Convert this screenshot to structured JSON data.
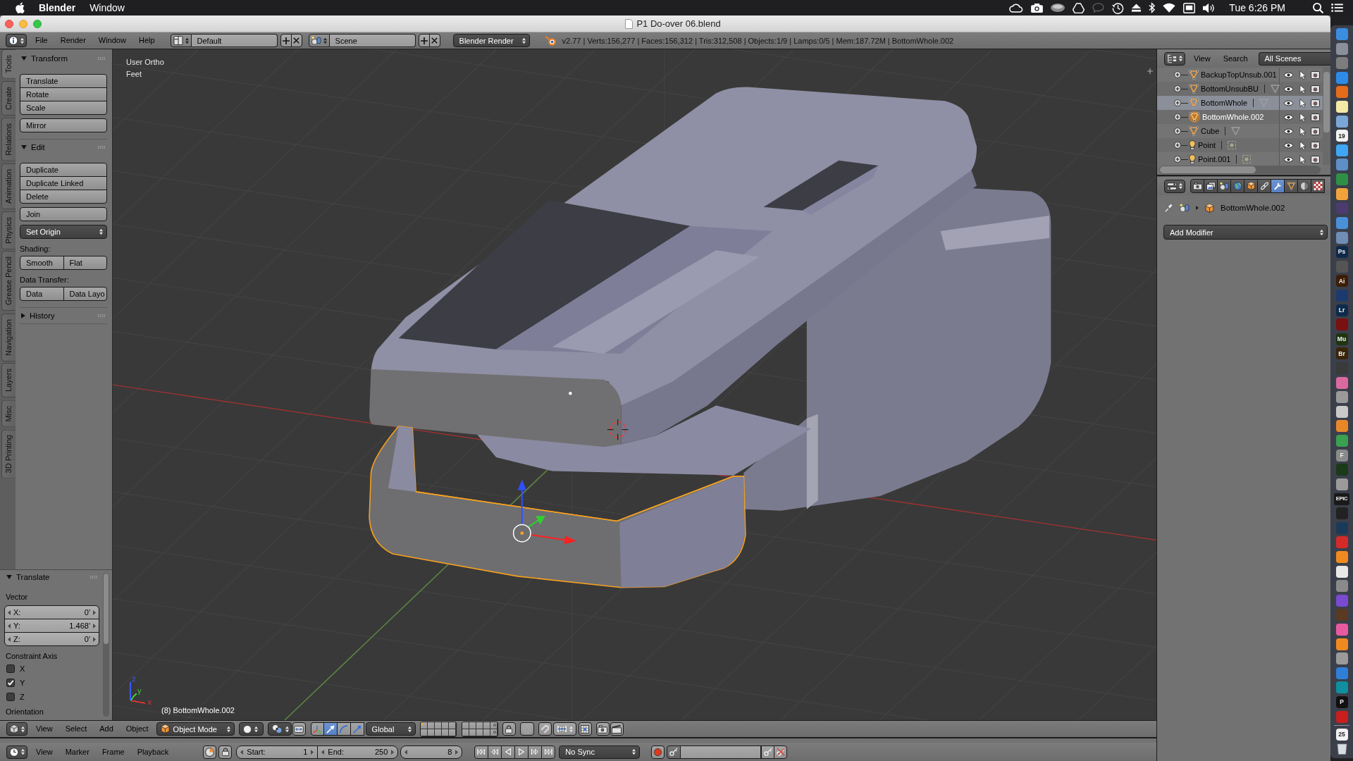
{
  "menu_bar": {
    "app_name": "Blender",
    "menus": [
      "Window"
    ],
    "clock": "Tue 6:26 PM"
  },
  "window": {
    "title": "P1 Do-over 06.blend"
  },
  "info_header": {
    "menus": [
      "File",
      "Render",
      "Window",
      "Help"
    ],
    "screen_layout": "Default",
    "scene": "Scene",
    "render_engine": "Blender Render",
    "stats": "v2.77 | Verts:156,277 | Faces:156,312 | Tris:312,508 | Objects:1/9 | Lamps:0/5 | Mem:187.72M | BottomWhole.002"
  },
  "tool_shelf": {
    "tabs": [
      {
        "label": "Tools",
        "selected": true
      },
      {
        "label": "Create",
        "selected": false
      },
      {
        "label": "Relations",
        "selected": false
      },
      {
        "label": "Animation",
        "selected": false
      },
      {
        "label": "Physics",
        "selected": false
      },
      {
        "label": "Grease Pencil",
        "selected": false
      },
      {
        "label": "Navigation",
        "selected": false
      },
      {
        "label": "Layers",
        "selected": false
      },
      {
        "label": "Misc",
        "selected": false
      },
      {
        "label": "3D Printing",
        "selected": false
      }
    ],
    "panels": [
      {
        "title": "Transform",
        "expanded": true,
        "items": [
          {
            "kind": "stack",
            "buttons": [
              "Translate",
              "Rotate",
              "Scale"
            ]
          },
          {
            "kind": "stack",
            "buttons": [
              "Mirror"
            ]
          }
        ]
      },
      {
        "title": "Edit",
        "expanded": true,
        "items": [
          {
            "kind": "stack",
            "buttons": [
              "Duplicate",
              "Duplicate Linked",
              "Delete"
            ]
          },
          {
            "kind": "stack",
            "buttons": [
              "Join"
            ]
          },
          {
            "kind": "dropdown",
            "label": "Set Origin"
          },
          {
            "kind": "label",
            "text": "Shading:"
          },
          {
            "kind": "row",
            "buttons": [
              "Smooth",
              "Flat"
            ]
          },
          {
            "kind": "label",
            "text": "Data Transfer:"
          },
          {
            "kind": "row",
            "buttons": [
              "Data",
              "Data Layo"
            ]
          }
        ]
      },
      {
        "title": "History",
        "expanded": false
      }
    ]
  },
  "operator_panel": {
    "title": "Translate",
    "expanded": true,
    "vector_label": "Vector",
    "vector": [
      {
        "axis": "X:",
        "value": "0'"
      },
      {
        "axis": "Y:",
        "value": "1.468'"
      },
      {
        "axis": "Z:",
        "value": "0'"
      }
    ],
    "constraint_label": "Constraint Axis",
    "constraint_axes": [
      {
        "label": "X",
        "checked": false
      },
      {
        "label": "Y",
        "checked": true
      },
      {
        "label": "Z",
        "checked": false
      }
    ],
    "orientation_label": "Orientation"
  },
  "viewport": {
    "view_name": "User Ortho",
    "units": "Feet",
    "gizmo_axes": [
      {
        "label": "x",
        "color": "#d23232"
      },
      {
        "label": "y",
        "color": "#3cc83c"
      },
      {
        "label": "z",
        "color": "#3c5aff"
      }
    ],
    "active_object": "(8) BottomWhole.002"
  },
  "view_header": {
    "menus": [
      "View",
      "Select",
      "Add",
      "Object"
    ],
    "mode": "Object Mode",
    "manipulators": [
      {
        "selected": true
      },
      {
        "selected": false
      },
      {
        "selected": false
      }
    ],
    "orientation": "Global",
    "layers": [
      {
        "kind": "active_object"
      },
      {
        "kind": "empty"
      },
      {
        "kind": "empty"
      },
      {
        "kind": "empty"
      },
      {
        "kind": "empty"
      },
      {
        "kind": "empty"
      },
      {
        "kind": "empty"
      },
      {
        "kind": "empty"
      },
      {
        "kind": "empty"
      },
      {
        "kind": "has_objects"
      },
      {
        "kind": "empty"
      },
      {
        "kind": "empty"
      },
      {
        "kind": "empty"
      },
      {
        "kind": "empty"
      },
      {
        "kind": "empty"
      },
      {
        "kind": "empty"
      },
      {
        "kind": "empty"
      },
      {
        "kind": "empty"
      },
      {
        "kind": "empty"
      },
      {
        "kind": "has_objects"
      }
    ]
  },
  "timeline_header": {
    "menus": [
      "View",
      "Marker",
      "Frame",
      "Playback"
    ],
    "start_label": "Start:",
    "start": "1",
    "end_label": "End:",
    "end": "250",
    "current_frame": "8",
    "sync": "No Sync"
  },
  "outliner": {
    "menus": [
      "View",
      "Search"
    ],
    "display_mode": "All Scenes",
    "items": [
      {
        "name": "BackupTopUnsub.001",
        "kind": "mesh",
        "selected": false,
        "active": false,
        "data_icon": false
      },
      {
        "name": "BottomUnsubBU",
        "kind": "mesh",
        "selected": false,
        "active": false,
        "data_icon": true
      },
      {
        "name": "BottomWhole",
        "kind": "mesh",
        "selected": true,
        "active": false,
        "data_icon": true
      },
      {
        "name": "BottomWhole.002",
        "kind": "mesh",
        "selected": false,
        "active": true,
        "data_icon": false
      },
      {
        "name": "Cube",
        "kind": "mesh",
        "selected": false,
        "active": false,
        "data_icon": true
      },
      {
        "name": "Point",
        "kind": "lamp",
        "selected": false,
        "active": false,
        "data_icon": true
      },
      {
        "name": "Point.001",
        "kind": "lamp",
        "selected": false,
        "active": false,
        "data_icon": true
      }
    ]
  },
  "properties": {
    "tabs": [
      {
        "selected": false
      },
      {
        "selected": false
      },
      {
        "selected": false
      },
      {
        "selected": false
      },
      {
        "selected": false
      },
      {
        "selected": false
      },
      {
        "selected": true
      },
      {
        "selected": false
      },
      {
        "selected": false
      },
      {
        "selected": false
      }
    ],
    "object_name": "BottomWhole.002",
    "add_modifier": "Add Modifier"
  },
  "dock": {
    "apps": [
      {
        "kind": "tile",
        "color": "#3b8de0"
      },
      {
        "kind": "tile",
        "color": "#8a8f99"
      },
      {
        "kind": "tile",
        "color": "#7d7d7d"
      },
      {
        "kind": "tile",
        "color": "#2e8be8"
      },
      {
        "kind": "tile",
        "color": "#e66b1b"
      },
      {
        "kind": "tile",
        "color": "#f5e9a8"
      },
      {
        "kind": "tile",
        "color": "#7aa7d8"
      },
      {
        "kind": "lettered",
        "color": "#f2f2f2",
        "label": "19"
      },
      {
        "kind": "tile",
        "color": "#3ea6f2"
      },
      {
        "kind": "tile",
        "color": "#5e8fc6"
      },
      {
        "kind": "tile",
        "color": "#2f8f45"
      },
      {
        "kind": "tile",
        "color": "#f0a33a"
      },
      {
        "kind": "tile",
        "color": "#4b3b6e"
      },
      {
        "kind": "tile",
        "color": "#4a90d9"
      },
      {
        "kind": "tile",
        "color": "#6f8db5"
      },
      {
        "kind": "lettered",
        "color": "#0d2a4a",
        "label": "Ps"
      },
      {
        "kind": "tile",
        "color": "#555555"
      },
      {
        "kind": "lettered",
        "color": "#3c1e05",
        "label": "Ai"
      },
      {
        "kind": "tile",
        "color": "#1d3a6e"
      },
      {
        "kind": "lettered",
        "color": "#0d2a4a",
        "label": "Lr"
      },
      {
        "kind": "tile",
        "color": "#7a1010"
      },
      {
        "kind": "lettered",
        "color": "#1e3510",
        "label": "Mu"
      },
      {
        "kind": "lettered",
        "color": "#3a2408",
        "label": "Br"
      },
      {
        "kind": "tile",
        "color": "#3a3a3a"
      },
      {
        "kind": "tile",
        "color": "#d86aa0"
      },
      {
        "kind": "tile",
        "color": "#9a9a9a"
      },
      {
        "kind": "tile",
        "color": "#c9c9c9"
      },
      {
        "kind": "tile",
        "color": "#e8872a"
      },
      {
        "kind": "tile",
        "color": "#3aa050"
      },
      {
        "kind": "lettered",
        "color": "#8a8a8a",
        "label": "F"
      },
      {
        "kind": "tile",
        "color": "#1a3a1a"
      },
      {
        "kind": "tile",
        "color": "#9a9a9a"
      },
      {
        "kind": "lettered",
        "color": "#1a1a1a",
        "label": "EPIC"
      },
      {
        "kind": "tile",
        "color": "#222222"
      },
      {
        "kind": "tile",
        "color": "#1b3a5a"
      },
      {
        "kind": "tile",
        "color": "#d42a2a"
      },
      {
        "kind": "tile",
        "color": "#f08a20"
      },
      {
        "kind": "tile",
        "color": "#e8e8e8"
      },
      {
        "kind": "tile",
        "color": "#8a8a8a"
      },
      {
        "kind": "tile",
        "color": "#7a4ad0"
      },
      {
        "kind": "tile",
        "color": "#5a3a20"
      },
      {
        "kind": "tile",
        "color": "#e85aa0"
      },
      {
        "kind": "tile",
        "color": "#f08a20"
      },
      {
        "kind": "tile",
        "color": "#9a9a9a"
      },
      {
        "kind": "tile",
        "color": "#2f7fd8"
      },
      {
        "kind": "tile",
        "color": "#0f8f9f"
      },
      {
        "kind": "lettered",
        "color": "#111111",
        "label": "P"
      },
      {
        "kind": "tile",
        "color": "#c81e1e"
      },
      {
        "kind": "separator"
      },
      {
        "kind": "lettered",
        "color": "#f2f2f2",
        "label": "25"
      },
      {
        "kind": "trash"
      }
    ]
  }
}
